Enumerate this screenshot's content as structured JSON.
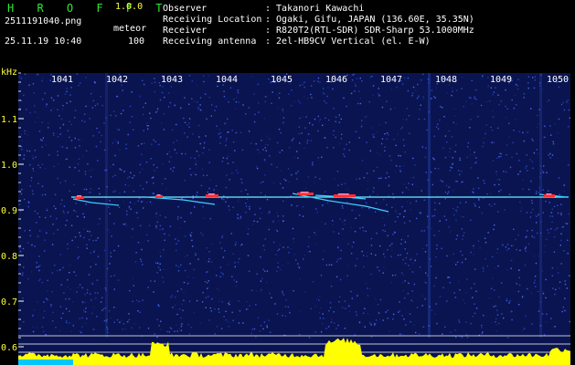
{
  "header": {
    "app_title": "H R O F F T",
    "app_version": "1.0.0",
    "filename": "2511191040.png",
    "mode": "meteor",
    "datetime": "25.11.19 10:40",
    "count": "100",
    "meta": [
      {
        "key": "Observer",
        "value": ": Takanori Kawachi"
      },
      {
        "key": "Receiving Location",
        "value": ": Ogaki, Gifu, JAPAN (136.60E, 35.35N)"
      },
      {
        "key": "Receiver",
        "value": ": R820T2(RTL-SDR) SDR-Sharp 53.1000MHz"
      },
      {
        "key": "Receiving antenna",
        "value": ": 2el-HB9CV Vertical (el. E-W)"
      }
    ]
  },
  "axis": {
    "y_unit": "kHz",
    "x_ticks": [
      "1041",
      "1042",
      "1043",
      "1044",
      "1045",
      "1046",
      "1047",
      "1048",
      "1049",
      "1050"
    ],
    "y_ticks": [
      "1.1",
      "1.0",
      "0.9",
      "0.8",
      "0.7",
      "0.6"
    ]
  },
  "colors": {
    "background": "#0a1450",
    "noise": "#2a48c8",
    "tick_text": "#ffffff",
    "axis_text": "#ffff3c",
    "signal": "#ff3030",
    "carrier": "#6ef0ff",
    "spectrum": "#ffff00"
  }
}
